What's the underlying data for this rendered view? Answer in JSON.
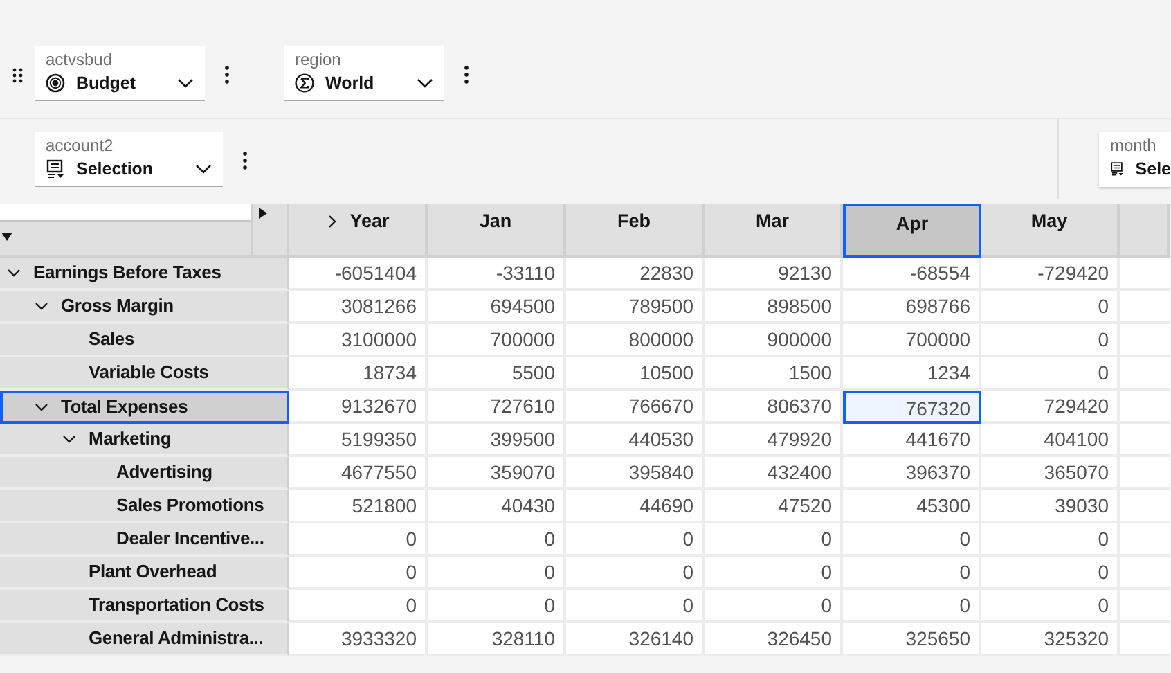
{
  "filters_row_1": [
    {
      "label": "actvsbud",
      "value": "Budget",
      "kind": "member"
    },
    {
      "label": "region",
      "value": "World",
      "kind": "consolidated"
    }
  ],
  "filters_row_2": [
    {
      "label": "account2",
      "value": "Selection",
      "kind": "subset"
    }
  ],
  "filters_right": [
    {
      "label": "month",
      "value": "Sele",
      "kind": "subset"
    }
  ],
  "columns": [
    {
      "label": "Year",
      "kind": "parent",
      "expanded": false,
      "selected": false
    },
    {
      "label": "Jan",
      "kind": "leaf",
      "selected": false
    },
    {
      "label": "Feb",
      "kind": "leaf",
      "selected": false
    },
    {
      "label": "Mar",
      "kind": "leaf",
      "selected": false
    },
    {
      "label": "Apr",
      "kind": "leaf",
      "selected": true
    },
    {
      "label": "May",
      "kind": "leaf",
      "selected": false
    }
  ],
  "rows": [
    {
      "label": "Earnings Before Taxes",
      "expanded": true,
      "selected": false,
      "cells": [
        {
          "value": "-6051404",
          "selected": false
        },
        {
          "value": "-33110",
          "selected": false
        },
        {
          "value": "22830",
          "selected": false
        },
        {
          "value": "92130",
          "selected": false
        },
        {
          "value": "-68554",
          "selected": false
        },
        {
          "value": "-729420",
          "selected": false
        }
      ],
      "children": [
        {
          "label": "Gross Margin",
          "expanded": true,
          "selected": false,
          "cells": [
            {
              "value": "3081266",
              "selected": false
            },
            {
              "value": "694500",
              "selected": false
            },
            {
              "value": "789500",
              "selected": false
            },
            {
              "value": "898500",
              "selected": false
            },
            {
              "value": "698766",
              "selected": false
            },
            {
              "value": "0",
              "selected": false
            }
          ],
          "children": [
            {
              "label": "Sales",
              "selected": false,
              "cells": [
                {
                  "value": "3100000",
                  "selected": false
                },
                {
                  "value": "700000",
                  "selected": false
                },
                {
                  "value": "800000",
                  "selected": false
                },
                {
                  "value": "900000",
                  "selected": false
                },
                {
                  "value": "700000",
                  "selected": false
                },
                {
                  "value": "0",
                  "selected": false
                }
              ]
            },
            {
              "label": "Variable Costs",
              "selected": false,
              "cells": [
                {
                  "value": "18734",
                  "selected": false
                },
                {
                  "value": "5500",
                  "selected": false
                },
                {
                  "value": "10500",
                  "selected": false
                },
                {
                  "value": "1500",
                  "selected": false
                },
                {
                  "value": "1234",
                  "selected": false
                },
                {
                  "value": "0",
                  "selected": false
                }
              ]
            }
          ]
        },
        {
          "label": "Total Expenses",
          "expanded": true,
          "selected": true,
          "cells": [
            {
              "value": "9132670",
              "selected": false
            },
            {
              "value": "727610",
              "selected": false
            },
            {
              "value": "766670",
              "selected": false
            },
            {
              "value": "806370",
              "selected": false
            },
            {
              "value": "767320",
              "selected": true
            },
            {
              "value": "729420",
              "selected": false
            }
          ],
          "children": [
            {
              "label": "Marketing",
              "expanded": true,
              "selected": false,
              "cells": [
                {
                  "value": "5199350",
                  "selected": false
                },
                {
                  "value": "399500",
                  "selected": false
                },
                {
                  "value": "440530",
                  "selected": false
                },
                {
                  "value": "479920",
                  "selected": false
                },
                {
                  "value": "441670",
                  "selected": false
                },
                {
                  "value": "404100",
                  "selected": false
                }
              ],
              "children": [
                {
                  "label": "Advertising",
                  "selected": false,
                  "cells": [
                    {
                      "value": "4677550",
                      "selected": false
                    },
                    {
                      "value": "359070",
                      "selected": false
                    },
                    {
                      "value": "395840",
                      "selected": false
                    },
                    {
                      "value": "432400",
                      "selected": false
                    },
                    {
                      "value": "396370",
                      "selected": false
                    },
                    {
                      "value": "365070",
                      "selected": false
                    }
                  ]
                },
                {
                  "label": "Sales Promotions",
                  "selected": false,
                  "cells": [
                    {
                      "value": "521800",
                      "selected": false
                    },
                    {
                      "value": "40430",
                      "selected": false
                    },
                    {
                      "value": "44690",
                      "selected": false
                    },
                    {
                      "value": "47520",
                      "selected": false
                    },
                    {
                      "value": "45300",
                      "selected": false
                    },
                    {
                      "value": "39030",
                      "selected": false
                    }
                  ]
                },
                {
                  "label": "Dealer Incentive...",
                  "selected": false,
                  "cells": [
                    {
                      "value": "0",
                      "selected": false
                    },
                    {
                      "value": "0",
                      "selected": false
                    },
                    {
                      "value": "0",
                      "selected": false
                    },
                    {
                      "value": "0",
                      "selected": false
                    },
                    {
                      "value": "0",
                      "selected": false
                    },
                    {
                      "value": "0",
                      "selected": false
                    }
                  ]
                }
              ]
            },
            {
              "label": "Plant Overhead",
              "selected": false,
              "cells": [
                {
                  "value": "0",
                  "selected": false
                },
                {
                  "value": "0",
                  "selected": false
                },
                {
                  "value": "0",
                  "selected": false
                },
                {
                  "value": "0",
                  "selected": false
                },
                {
                  "value": "0",
                  "selected": false
                },
                {
                  "value": "0",
                  "selected": false
                }
              ]
            },
            {
              "label": "Transportation Costs",
              "selected": false,
              "cells": [
                {
                  "value": "0",
                  "selected": false
                },
                {
                  "value": "0",
                  "selected": false
                },
                {
                  "value": "0",
                  "selected": false
                },
                {
                  "value": "0",
                  "selected": false
                },
                {
                  "value": "0",
                  "selected": false
                },
                {
                  "value": "0",
                  "selected": false
                }
              ]
            },
            {
              "label": "General Administra...",
              "selected": false,
              "cells": [
                {
                  "value": "3933320",
                  "selected": false
                },
                {
                  "value": "328110",
                  "selected": false
                },
                {
                  "value": "326140",
                  "selected": false
                },
                {
                  "value": "326450",
                  "selected": false
                },
                {
                  "value": "325650",
                  "selected": false
                },
                {
                  "value": "325320",
                  "selected": false
                }
              ]
            }
          ]
        }
      ]
    }
  ]
}
